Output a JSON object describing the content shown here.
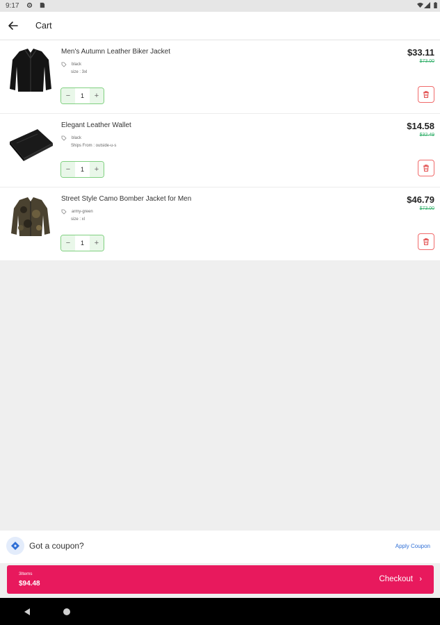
{
  "status_bar": {
    "time": "9:17",
    "icons": [
      "gear-icon",
      "sd-card-icon",
      "wifi-icon",
      "signal-icon",
      "battery-icon"
    ]
  },
  "app_bar": {
    "title": "Cart",
    "back_icon": "arrow-left-icon"
  },
  "cart_items": [
    {
      "name": "Men's Autumn Leather Biker Jacket",
      "color": "black",
      "size": "size : 3xl",
      "price": "$33.11",
      "old_price": "$73.00",
      "quantity": "1",
      "image": "leather-jacket"
    },
    {
      "name": "Elegant Leather Wallet",
      "color": "black",
      "size": "Ships From : outside-u-s",
      "price": "$14.58",
      "old_price": "$32.49",
      "quantity": "1",
      "image": "leather-wallet"
    },
    {
      "name": "Street Style Camo Bomber Jacket for Men",
      "color": "army-green",
      "size": "size : xl",
      "price": "$46.79",
      "old_price": "$73.00",
      "quantity": "1",
      "image": "camo-bomber-jacket"
    }
  ],
  "stepper": {
    "decrement": "−",
    "increment": "+"
  },
  "coupon": {
    "label": "Got a coupon?",
    "action": "Apply Coupon",
    "icon": "coupon-tag-icon"
  },
  "checkout": {
    "items_label": "3Items",
    "total": "$94.48",
    "label": "Checkout",
    "chevron": "›"
  },
  "colors": {
    "accent": "#e8195d",
    "link": "#2f6fd6",
    "discount_green": "#3cb371",
    "delete_red": "#f06a6a",
    "stepper_border": "#7fd07f"
  }
}
